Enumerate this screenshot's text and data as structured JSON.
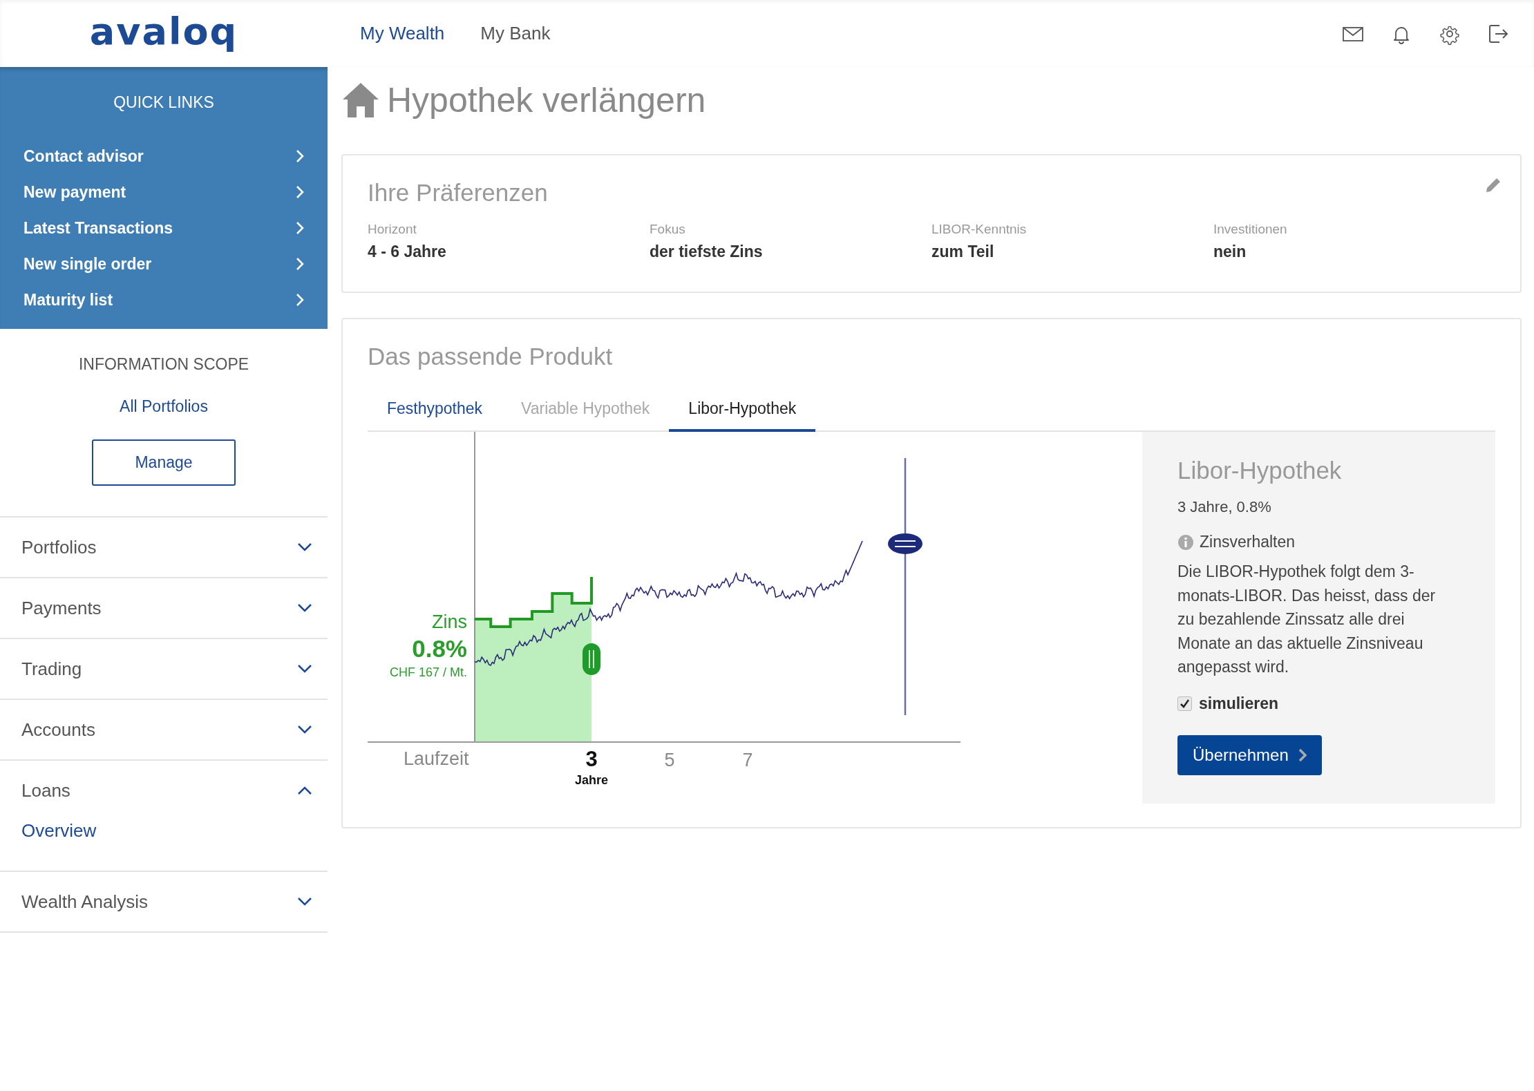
{
  "header": {
    "logo": "avaloq",
    "nav": [
      {
        "label": "My Wealth",
        "selected": true
      },
      {
        "label": "My Bank",
        "selected": false
      }
    ]
  },
  "sidebar": {
    "quick_links": {
      "title": "QUICK LINKS",
      "items": [
        {
          "label": "Contact advisor"
        },
        {
          "label": "New payment"
        },
        {
          "label": "Latest Transactions"
        },
        {
          "label": "New single order"
        },
        {
          "label": "Maturity list"
        }
      ]
    },
    "scope": {
      "title": "INFORMATION SCOPE",
      "value": "All Portfolios",
      "button": "Manage"
    },
    "menu": [
      {
        "label": "Portfolios",
        "expanded": false
      },
      {
        "label": "Payments",
        "expanded": false
      },
      {
        "label": "Trading",
        "expanded": false
      },
      {
        "label": "Accounts",
        "expanded": false
      },
      {
        "label": "Loans",
        "expanded": true,
        "children": [
          {
            "label": "Overview"
          }
        ]
      },
      {
        "label": "Wealth Analysis",
        "expanded": false
      }
    ]
  },
  "page_title": "Hypothek verlängern",
  "preferences": {
    "title": "Ihre Präferenzen",
    "fields": [
      {
        "label": "Horizont",
        "value": "4 - 6 Jahre"
      },
      {
        "label": "Fokus",
        "value": "der tiefste Zins"
      },
      {
        "label": "LIBOR-Kenntnis",
        "value": "zum Teil"
      },
      {
        "label": "Investitionen",
        "value": "nein"
      }
    ]
  },
  "product": {
    "title": "Das passende Produkt",
    "tabs": [
      {
        "label": "Festhypothek",
        "selected": false,
        "disabled": false
      },
      {
        "label": "Variable Hypothek",
        "selected": false,
        "disabled": true
      },
      {
        "label": "Libor-Hypothek",
        "selected": true,
        "disabled": false
      }
    ],
    "chart": {
      "range_slider": {
        "level": 0.667
      },
      "rate_label": "Zins",
      "rate": "0.8%",
      "monthly": "CHF 167 / Mt.",
      "axis_label": "Laufzeit",
      "ticks": [
        {
          "label": "3",
          "unit": "Jahre",
          "selected": true
        },
        {
          "label": "5",
          "selected": false
        },
        {
          "label": "7",
          "selected": false
        }
      ]
    },
    "detail": {
      "title": "Libor-Hypothek",
      "summary": "3 Jahre, 0.8%",
      "info_label": "Zinsverhalten",
      "text": "Die LIBOR-Hypothek folgt dem 3-monats-LIBOR. Das heisst, dass der zu bezahlende Zinssatz alle drei Monate an das aktuelle Zinsniveau angepasst wird.",
      "simulate": {
        "label": "simulieren",
        "checked": true
      },
      "button": "Übernehmen"
    }
  }
}
